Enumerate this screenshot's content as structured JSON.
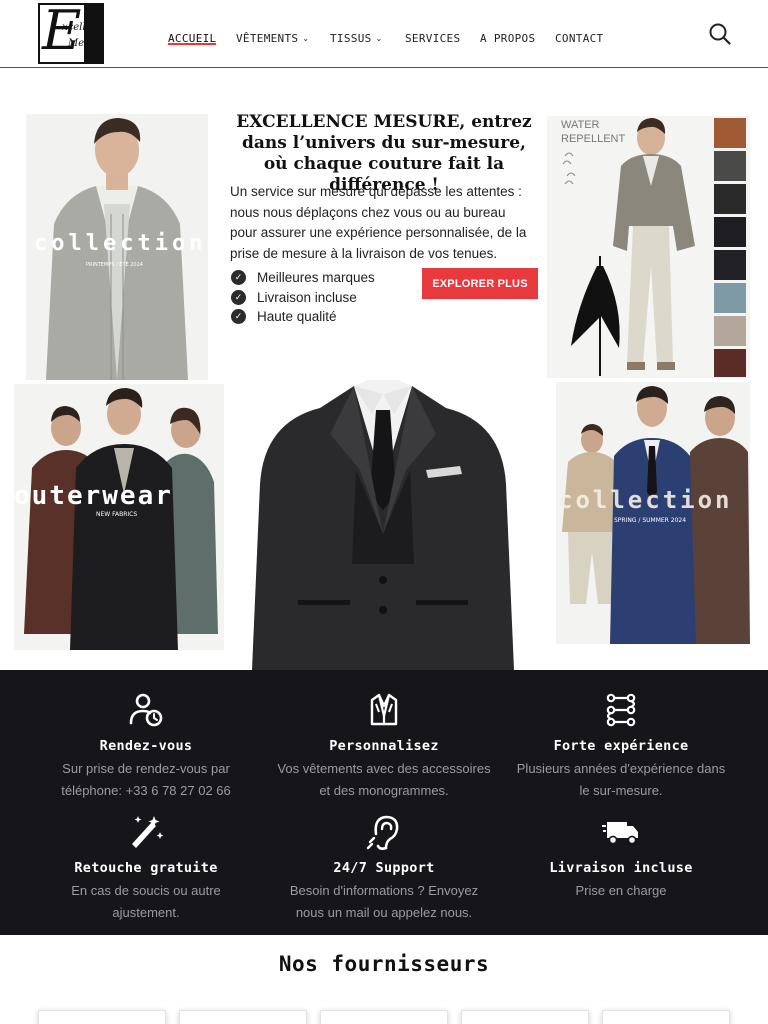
{
  "header": {
    "logo": {
      "line1": "xcellence",
      "line2": "Mesure",
      "letter": "E"
    },
    "nav": [
      {
        "label": "ACCUEIL",
        "active": true,
        "has_dropdown": false
      },
      {
        "label": "VÊTEMENTS",
        "active": false,
        "has_dropdown": true
      },
      {
        "label": "TISSUS",
        "active": false,
        "has_dropdown": true
      },
      {
        "label": "SERVICES",
        "active": false,
        "has_dropdown": false
      },
      {
        "label": "A PROPOS",
        "active": false,
        "has_dropdown": false
      },
      {
        "label": "CONTACT",
        "active": false,
        "has_dropdown": false
      }
    ],
    "search_icon": "search-icon"
  },
  "hero": {
    "title": "EXCELLENCE MESURE, entrez dans l’univers du sur-mesure, où chaque couture fait la différence !",
    "description": "Un service sur mesure qui dépasse les attentes : nous nous déplaçons chez vous ou au bureau pour assurer une expérience personnalisée, de la prise de mesure à la livraison de vos tenues.",
    "features": [
      "Meilleures marques",
      "Livraison incluse",
      "Haute qualité"
    ],
    "cta_label": "EXPLORER PLUS",
    "photos": {
      "top_left": {
        "overlay": "collection",
        "sub": "PRINTEMPS / ÉTÉ 2024"
      },
      "top_right": {
        "overlay_line1": "WATER",
        "overlay_line2": "REPELLENT"
      },
      "bottom_left": {
        "overlay": "outerwear",
        "sub": "NEW FABRICS"
      },
      "bottom_right": {
        "overlay": "collection",
        "sub": "SPRING / SUMMER 2024"
      }
    }
  },
  "features_band": [
    {
      "icon": "appointment-icon",
      "title": "Rendez-vous",
      "text": "Sur prise de rendez-vous par téléphone: +33 6 78 27 02 66"
    },
    {
      "icon": "suit-icon",
      "title": "Personnalisez",
      "text": "Vos vêtements avec des accessoires et des monogrammes."
    },
    {
      "icon": "experience-icon",
      "title": "Forte expérience",
      "text": "Plusieurs années d'expérience dans le sur-mesure."
    },
    {
      "icon": "magic-wand-icon",
      "title": "Retouche gratuite",
      "text": "En cas de soucis ou autre ajustement."
    },
    {
      "icon": "support-icon",
      "title": "24/7 Support",
      "text": "Besoin d'informations ? Envoyez nous un mail ou appelez nous."
    },
    {
      "icon": "delivery-truck-icon",
      "title": "Livraison incluse",
      "text": "Prise en charge"
    }
  ],
  "suppliers": {
    "title": "Nos fournisseurs"
  },
  "colors": {
    "accent": "#e8393f",
    "band_bg": "#16151a",
    "band_text": "#9b9ba3"
  }
}
